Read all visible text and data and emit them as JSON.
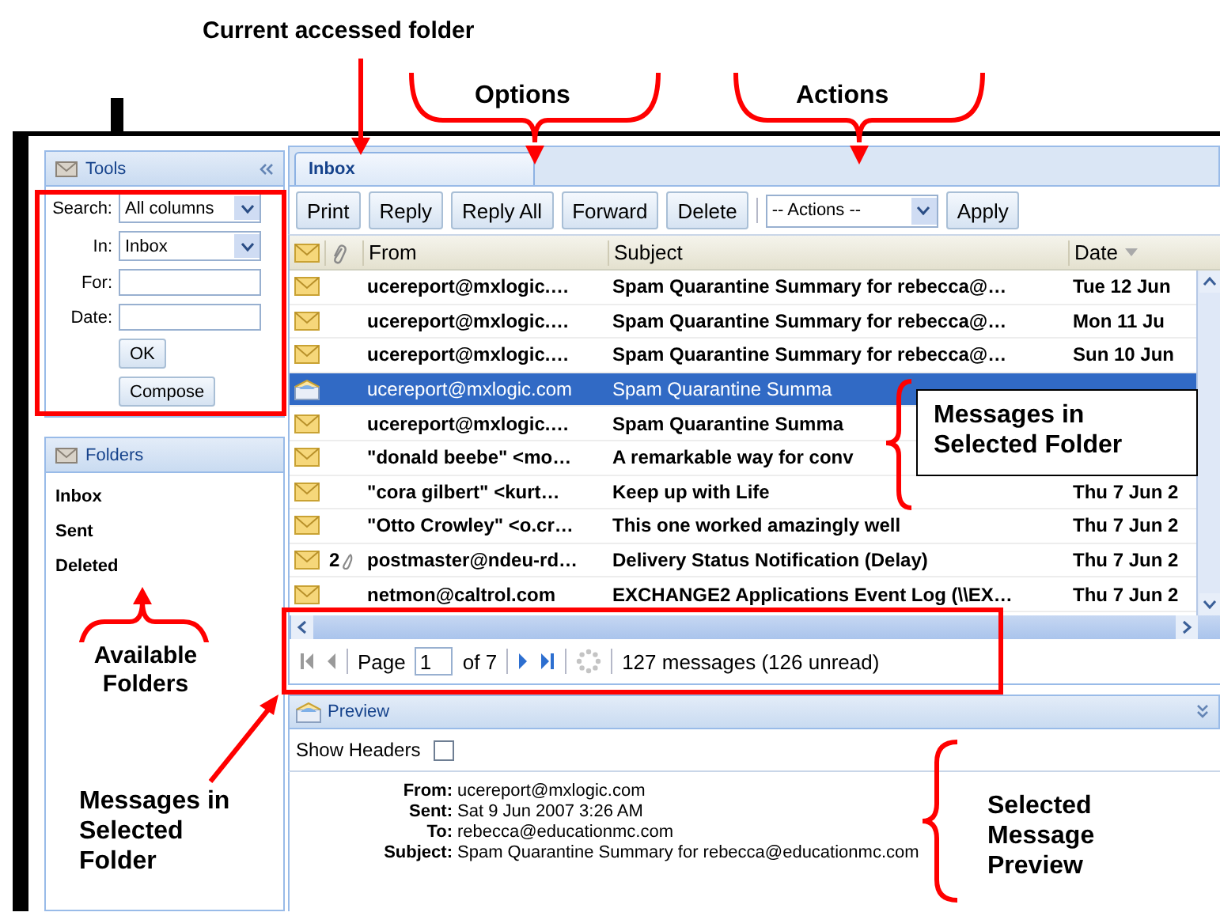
{
  "annotations": {
    "current_folder": "Current accessed folder",
    "options": "Options",
    "actions": "Actions",
    "messages_callout": "Messages in Selected Folder",
    "available_folders": "Available Folders",
    "paging_note": "Messages in Selected Folder",
    "preview_note": "Selected Message Preview"
  },
  "tools": {
    "title": "Tools",
    "fields": [
      {
        "label": "Search:",
        "kind": "select",
        "value": "All columns"
      },
      {
        "label": "In:",
        "kind": "select",
        "value": "Inbox"
      },
      {
        "label": "For:",
        "kind": "text"
      },
      {
        "label": "Date:",
        "kind": "text"
      }
    ],
    "buttons": [
      "OK",
      "Compose"
    ]
  },
  "folders": {
    "title": "Folders",
    "items": [
      "Inbox",
      "Sent",
      "Deleted"
    ]
  },
  "tabs": [
    {
      "label": "Inbox",
      "selected": true
    }
  ],
  "toolbar": {
    "buttons": [
      "Print",
      "Reply",
      "Reply All",
      "Forward",
      "Delete"
    ],
    "actions": "-- Actions --",
    "apply": "Apply"
  },
  "grid": {
    "columns": [
      "From",
      "Subject",
      "Date"
    ],
    "rows": [
      {
        "from": "ucereport@mxlogic.…",
        "subject": "Spam Quarantine Summary for rebecca@…",
        "date": "Tue 12 Jun",
        "unread": true,
        "selected": false
      },
      {
        "from": "ucereport@mxlogic.…",
        "subject": "Spam Quarantine Summary for rebecca@…",
        "date": "Mon 11 Ju",
        "unread": true,
        "selected": false
      },
      {
        "from": "ucereport@mxlogic.…",
        "subject": "Spam Quarantine Summary for rebecca@…",
        "date": "Sun 10 Jun",
        "unread": true,
        "selected": false
      },
      {
        "from": "ucereport@mxlogic.com",
        "subject": "Spam Quarantine Summa",
        "unread": false,
        "selected": true
      },
      {
        "from": "ucereport@mxlogic.…",
        "subject": "Spam Quarantine Summa",
        "unread": true,
        "selected": false
      },
      {
        "from": "\"donald beebe\" <mo…",
        "subject": "A remarkable way for conv",
        "unread": true,
        "selected": false
      },
      {
        "from": "\"cora gilbert\" <kurt…",
        "subject": "Keep up with Life",
        "date": "Thu 7 Jun 2",
        "unread": true,
        "selected": false
      },
      {
        "from": "\"Otto Crowley\" <o.cr…",
        "subject": "This one worked amazingly well",
        "date": "Thu 7 Jun 2",
        "unread": true,
        "selected": false
      },
      {
        "from": "postmaster@ndeu-rd…",
        "subject": "Delivery Status Notification (Delay)",
        "date": "Thu 7 Jun 2",
        "attachments": "2",
        "unread": true,
        "selected": false
      },
      {
        "from": "netmon@caltrol.com",
        "subject": "EXCHANGE2 Applications Event Log (\\\\EX…",
        "date": "Thu 7 Jun 2",
        "unread": true,
        "selected": false
      }
    ]
  },
  "paging": {
    "page_label": "Page",
    "page": "1",
    "of": "of 7",
    "status": "127 messages (126 unread)"
  },
  "preview": {
    "title": "Preview",
    "show_headers_label": "Show Headers",
    "show_headers": false,
    "headers": [
      {
        "label": "From:",
        "value": "ucereport@mxlogic.com"
      },
      {
        "label": "Sent:",
        "value": "Sat 9 Jun 2007 3:26 AM"
      },
      {
        "label": "To:",
        "value": "rebecca@educationmc.com"
      },
      {
        "label": "Subject:",
        "value": "Spam Quarantine Summary for rebecca@educationmc.com"
      }
    ]
  }
}
